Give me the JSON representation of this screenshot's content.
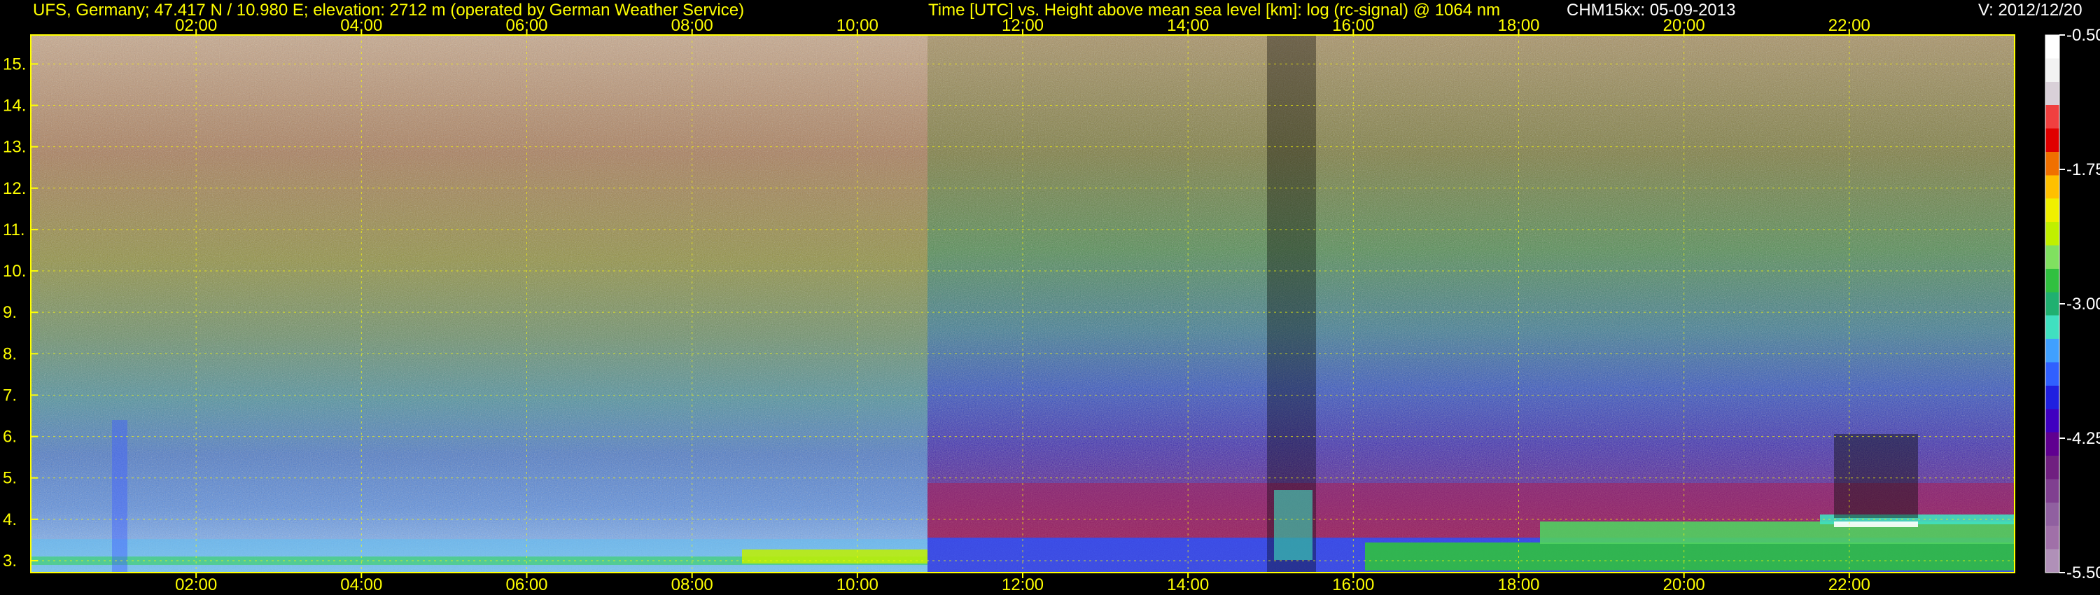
{
  "header": {
    "station": "UFS, Germany; 47.417 N / 10.980 E; elevation: 2712 m  (operated by German Weather Service)",
    "axes_desc": "Time [UTC] vs. Height above mean sea level [km]: log (rc-signal) @ 1064 nm",
    "instrument": "CHM15kx: 05-09-2013",
    "version": "V: 2012/12/20"
  },
  "colors": {
    "axis": "#ffff00",
    "grid": "#ffff00",
    "background": "#000000"
  },
  "chart_data": {
    "type": "heatmap",
    "title": "Time [UTC] vs. Height above mean sea level [km]: log (rc-signal) @ 1064 nm",
    "x_ticks": [
      "02:00",
      "04:00",
      "06:00",
      "08:00",
      "10:00",
      "12:00",
      "14:00",
      "16:00",
      "18:00",
      "20:00",
      "22:00"
    ],
    "x_tick_hours": [
      2,
      4,
      6,
      8,
      10,
      12,
      14,
      16,
      18,
      20,
      22
    ],
    "xlim_hours": [
      0,
      24
    ],
    "y_ticks": [
      "3.",
      "4.",
      "5.",
      "6.",
      "7.",
      "8.",
      "9.",
      "10.",
      "11.",
      "12.",
      "13.",
      "14.",
      "15."
    ],
    "y_tick_values": [
      3,
      4,
      5,
      6,
      7,
      8,
      9,
      10,
      11,
      12,
      13,
      14,
      15
    ],
    "ylim_km": [
      2.712,
      15.7
    ],
    "grid": true,
    "colorbar": {
      "tick_labels": [
        "-0.50",
        "-1.75",
        "-3.00",
        "-4.25",
        "-5.50"
      ],
      "tick_values": [
        -0.5,
        -1.75,
        -3.0,
        -4.25,
        -5.5
      ],
      "range": [
        -5.5,
        -0.5
      ],
      "colors_top_to_bottom": [
        "#ffffff",
        "#f2f2f2",
        "#d9d0d8",
        "#f04040",
        "#e00000",
        "#f07000",
        "#ffc000",
        "#f0f000",
        "#c0f000",
        "#80e060",
        "#30c040",
        "#20b070",
        "#40e0c0",
        "#40a0ff",
        "#3060ff",
        "#2020e0",
        "#4000c0",
        "#600090",
        "#702080",
        "#804090",
        "#9060a0",
        "#a070a8",
        "#b090b8"
      ]
    }
  }
}
